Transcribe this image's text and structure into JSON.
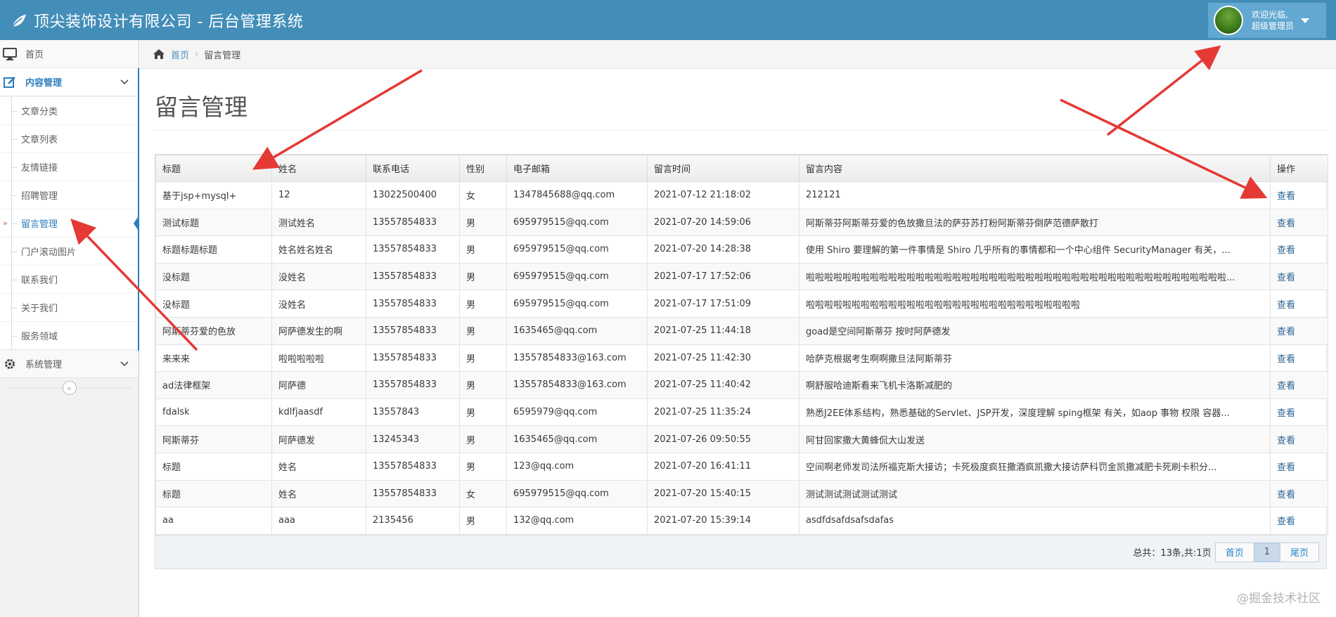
{
  "app": {
    "title": "顶尖装饰设计有限公司 - 后台管理系统",
    "welcome_line1": "欢迎光临,",
    "welcome_line2": "超级管理员"
  },
  "sidebar": {
    "home": "首页",
    "content_group": "内容管理",
    "items": [
      {
        "label": "文章分类"
      },
      {
        "label": "文章列表"
      },
      {
        "label": "友情链接"
      },
      {
        "label": "招聘管理"
      },
      {
        "label": "留言管理",
        "active": true
      },
      {
        "label": "门户滚动图片"
      },
      {
        "label": "联系我们"
      },
      {
        "label": "关于我们"
      },
      {
        "label": "服务领域"
      }
    ],
    "system_group": "系统管理"
  },
  "breadcrumb": {
    "home": "首页",
    "current": "留言管理"
  },
  "page": {
    "title": "留言管理"
  },
  "table": {
    "headers": [
      "标题",
      "姓名",
      "联系电话",
      "性别",
      "电子邮箱",
      "留言时间",
      "留言内容",
      "操作"
    ],
    "action_label": "查看",
    "rows": [
      [
        "基于jsp+mysql+",
        "12",
        "13022500400",
        "女",
        "1347845688@qq.com",
        "2021-07-12 21:18:02",
        "212121"
      ],
      [
        "测试标题",
        "测试姓名",
        "13557854833",
        "男",
        "695979515@qq.com",
        "2021-07-20 14:59:06",
        "阿斯蒂芬阿斯蒂芬爱的色放撒旦法的萨芬苏打粉阿斯蒂芬倒萨范德萨散打"
      ],
      [
        "标题标题标题",
        "姓名姓名姓名",
        "13557854833",
        "男",
        "695979515@qq.com",
        "2021-07-20 14:28:38",
        "使用 Shiro 要理解的第一件事情是 Shiro 几乎所有的事情都和一个中心组件 SecurityManager 有关，..."
      ],
      [
        "没标题",
        "没姓名",
        "13557854833",
        "男",
        "695979515@qq.com",
        "2021-07-17 17:52:06",
        "啦啦啦啦啦啦啦啦啦啦啦啦啦啦啦啦啦啦啦啦啦啦啦啦啦啦啦啦啦啦啦啦啦啦啦啦啦啦啦啦啦啦啦啦啦啦..."
      ],
      [
        "没标题",
        "没姓名",
        "13557854833",
        "男",
        "695979515@qq.com",
        "2021-07-17 17:51:09",
        "啦啦啦啦啦啦啦啦啦啦啦啦啦啦啦啦啦啦啦啦啦啦啦啦啦啦啦啦啦啦"
      ],
      [
        "阿斯蒂芬爱的色放",
        "阿萨德发生的啊",
        "13557854833",
        "男",
        "1635465@qq.com",
        "2021-07-25 11:44:18",
        "goad是空间阿斯蒂芬 按时阿萨德发"
      ],
      [
        "来来来",
        "啦啦啦啦啦",
        "13557854833",
        "男",
        "13557854833@163.com",
        "2021-07-25 11:42:30",
        "哈萨克根据考生啊啊撒旦法阿斯蒂芬"
      ],
      [
        "ad法律框架",
        "阿萨德",
        "13557854833",
        "男",
        "13557854833@163.com",
        "2021-07-25 11:40:42",
        "啊舒服哈迪斯看来飞机卡洛斯减肥的"
      ],
      [
        "fdalsk",
        "kdlfjaasdf",
        "13557843",
        "男",
        "6595979@qq.com",
        "2021-07-25 11:35:24",
        "熟悉J2EE体系结构，熟悉基础的Servlet、JSP开发，深度理解 sping框架 有关，如aop 事物 权限 容器..."
      ],
      [
        "阿斯蒂芬",
        "阿萨德发",
        "13245343",
        "男",
        "1635465@qq.com",
        "2021-07-26 09:50:55",
        "阿甘回家撒大黄蜂侃大山发送"
      ],
      [
        "标题",
        "姓名",
        "13557854833",
        "男",
        "123@qq.com",
        "2021-07-20 16:41:11",
        "空间啊老师发司法所福克斯大接访；卡死极度疯狂撒酒疯凯撒大接访萨科罚金凯撒减肥卡死刷卡积分..."
      ],
      [
        "标题",
        "姓名",
        "13557854833",
        "女",
        "695979515@qq.com",
        "2021-07-20 15:40:15",
        "测试测试测试测试测试"
      ],
      [
        "aa",
        "aaa",
        "2135456",
        "男",
        "132@qq.com",
        "2021-07-20 15:39:14",
        "asdfdsafdsafsdafas"
      ]
    ]
  },
  "pager": {
    "info": "总共：13条,共:1页",
    "first": "首页",
    "current": "1",
    "last": "尾页"
  },
  "watermark": "@掘金技术社区",
  "colors": {
    "navbar": "#438eb9",
    "accent": "#2b7dbc",
    "annotation_arrow": "#e53935"
  }
}
